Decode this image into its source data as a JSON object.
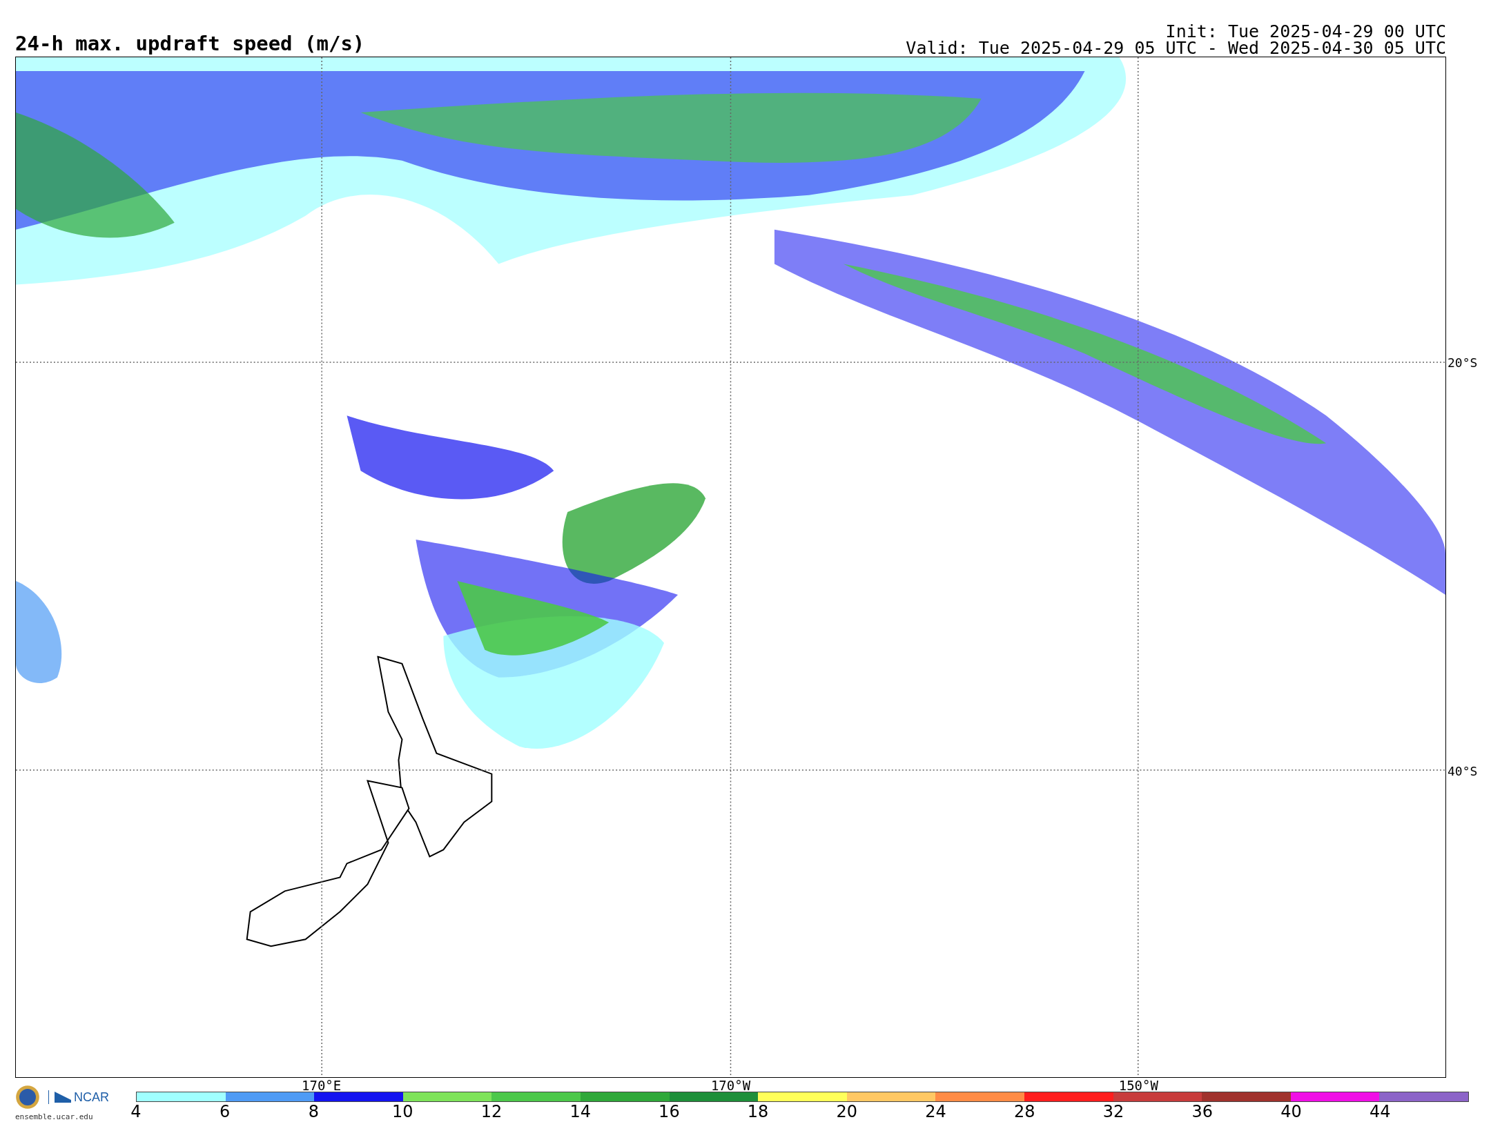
{
  "title": "24-h max. updraft speed (m/s)",
  "init": "Init: Tue 2025-04-29 00 UTC",
  "valid": "Valid: Tue 2025-04-29 05 UTC - Wed 2025-04-30 05 UTC",
  "map": {
    "latitudes": [
      "20°S",
      "40°S"
    ],
    "longitudes": [
      "170°E",
      "170°W",
      "150°W"
    ]
  },
  "logo": {
    "name": "NCAR",
    "site": "ensemble.ucar.edu"
  },
  "colorbar": {
    "bins": [
      {
        "color": "#a0ffff"
      },
      {
        "color": "#4f9bf5"
      },
      {
        "color": "#1414f0"
      },
      {
        "color": "#7ee35a"
      },
      {
        "color": "#4cc84a"
      },
      {
        "color": "#2fa83a"
      },
      {
        "color": "#1e8f3a"
      },
      {
        "color": "#ffff5a"
      },
      {
        "color": "#ffc864"
      },
      {
        "color": "#ff8c46"
      },
      {
        "color": "#ff1e1e"
      },
      {
        "color": "#c83c3c"
      },
      {
        "color": "#a0322d"
      },
      {
        "color": "#f00fe6"
      },
      {
        "color": "#8c64c8"
      }
    ],
    "ticks": [
      "4",
      "6",
      "8",
      "10",
      "12",
      "14",
      "16",
      "18",
      "20",
      "24",
      "28",
      "32",
      "36",
      "40",
      "44"
    ]
  }
}
